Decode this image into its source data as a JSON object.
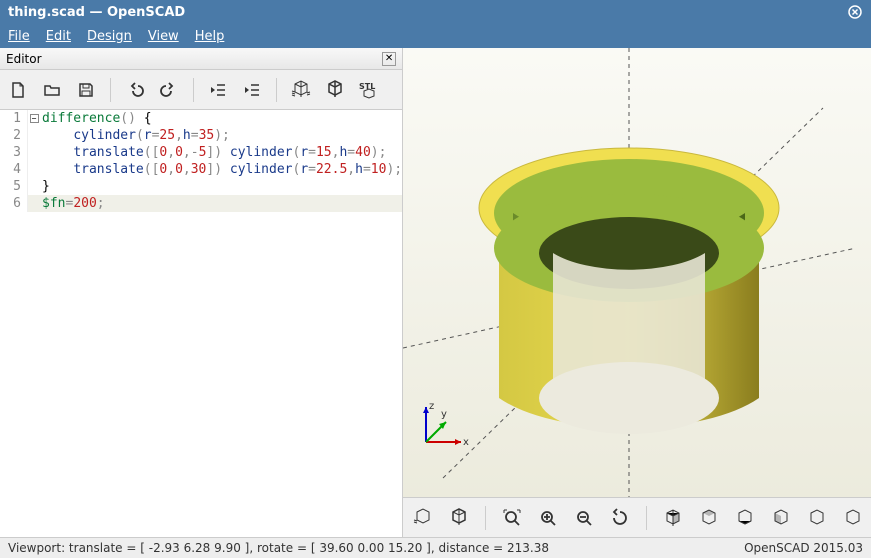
{
  "title": "thing.scad — OpenSCAD",
  "menus": {
    "file": "File",
    "edit": "Edit",
    "design": "Design",
    "view": "View",
    "help": "Help"
  },
  "editor": {
    "header": "Editor",
    "lines": {
      "l1a": "difference",
      "l1b": "()",
      "l1c": " {",
      "l2a": "    ",
      "l2b": "cylinder",
      "l2c": "(",
      "l2d": "r",
      "l2e": "=",
      "l2f": "25",
      "l2g": ",",
      "l2h": "h",
      "l2i": "=",
      "l2j": "35",
      "l2k": ");",
      "l3a": "    ",
      "l3b": "translate",
      "l3c": "([",
      "l3d": "0",
      "l3e": ",",
      "l3f": "0",
      "l3g": ",-",
      "l3h": "5",
      "l3i": "])",
      "l3j": " ",
      "l3k": "cylinder",
      "l3l": "(",
      "l3m": "r",
      "l3n": "=",
      "l3o": "15",
      "l3p": ",",
      "l3q": "h",
      "l3r": "=",
      "l3s": "40",
      "l3t": ");",
      "l4a": "    ",
      "l4b": "translate",
      "l4c": "([",
      "l4d": "0",
      "l4e": ",",
      "l4f": "0",
      "l4g": ",",
      "l4h": "30",
      "l4i": "])",
      "l4j": " ",
      "l4k": "cylinder",
      "l4l": "(",
      "l4m": "r",
      "l4n": "=",
      "l4o": "22.5",
      "l4p": ",",
      "l4q": "h",
      "l4r": "=",
      "l4s": "10",
      "l4t": ");",
      "l5a": "}",
      "l6a": "$fn",
      "l6b": "=",
      "l6c": "200",
      "l6d": ";"
    },
    "linenums": [
      "1",
      "2",
      "3",
      "4",
      "5",
      "6"
    ]
  },
  "axes": {
    "x": "x",
    "y": "y",
    "z": "z"
  },
  "status": {
    "viewport": "Viewport: translate = [ -2.93 6.28 9.90 ], rotate = [ 39.60 0.00 15.20 ], distance = 213.38",
    "version": "OpenSCAD 2015.03"
  },
  "icons": {
    "new": "new-icon",
    "open": "open-icon",
    "save": "save-icon",
    "undo": "undo-icon",
    "redo": "redo-icon",
    "unindent": "unindent-icon",
    "indent": "indent-icon",
    "preview": "preview-icon",
    "render": "render-icon",
    "stl": "stl-icon",
    "v_preview": "preview-icon",
    "v_render": "render-icon",
    "v_viewall": "view-all-icon",
    "v_zoomin": "zoom-in-icon",
    "v_zoomout": "zoom-out-icon",
    "v_reset": "reset-view-icon",
    "v_right": "right-icon",
    "v_top": "top-icon",
    "v_bottom": "bottom-icon",
    "v_left": "left-icon",
    "v_front": "front-icon",
    "v_back": "back-icon",
    "v_over": "overflow-icon"
  }
}
